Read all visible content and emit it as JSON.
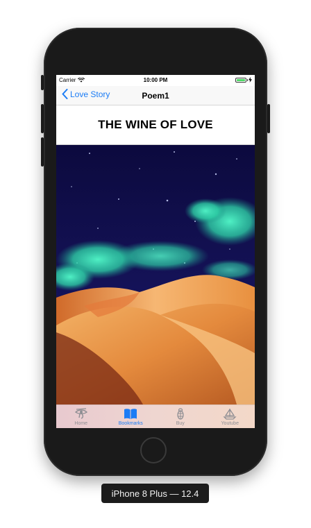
{
  "status_bar": {
    "carrier": "Carrier",
    "time": "10:00 PM"
  },
  "nav": {
    "back_label": "Love Story",
    "title": "Poem1"
  },
  "poem": {
    "title": "THE WINE OF LOVE"
  },
  "tabs": [
    {
      "label": "Home",
      "icon": "eye-of-horus-icon",
      "active": false
    },
    {
      "label": "Bookmarks",
      "icon": "open-book-icon",
      "active": true
    },
    {
      "label": "Buy",
      "icon": "scarab-icon",
      "active": false
    },
    {
      "label": "Youtube",
      "icon": "sailboat-icon",
      "active": false
    }
  ],
  "device_label": "iPhone 8 Plus — 12.4",
  "colors": {
    "accent": "#1b7cf5",
    "tab_inactive": "#8e8e93",
    "battery": "#4cd964"
  }
}
